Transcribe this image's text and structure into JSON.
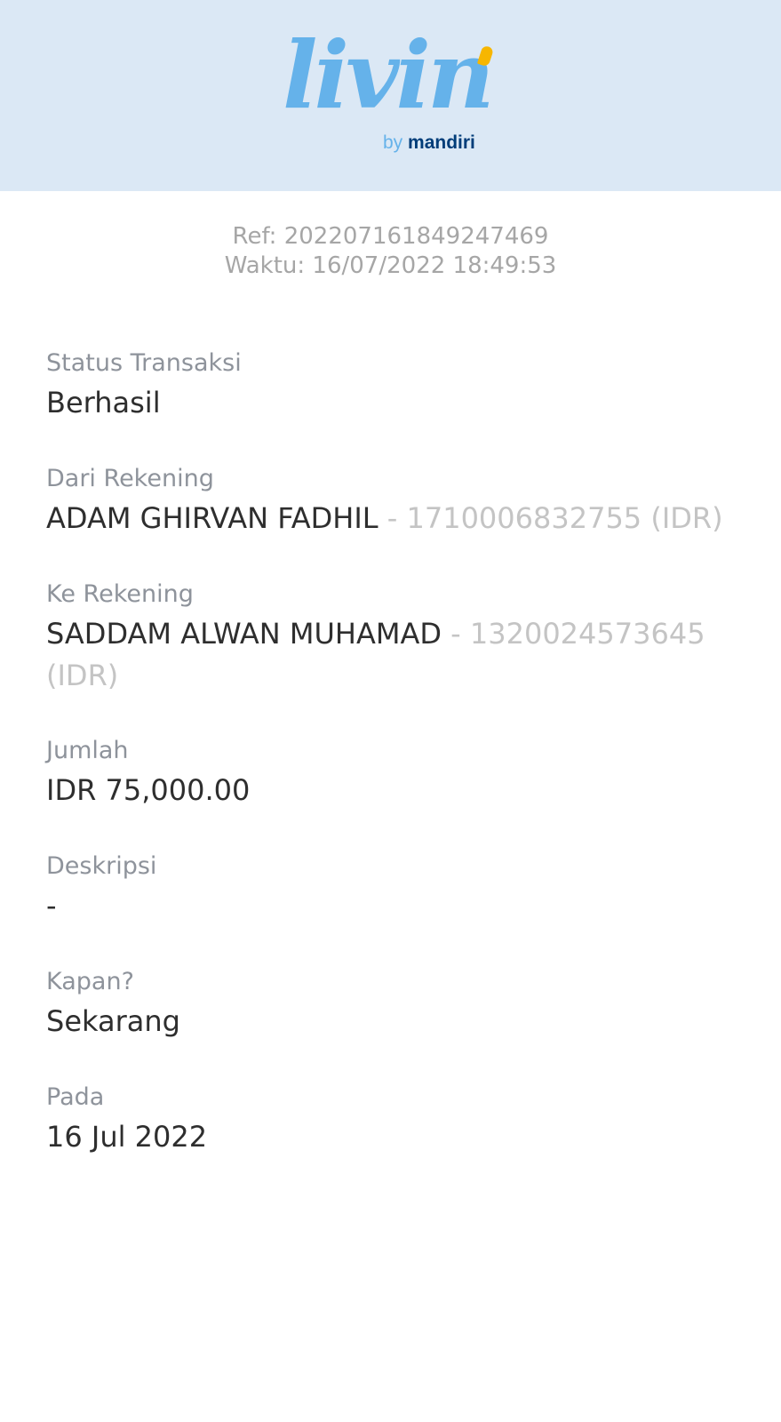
{
  "header": {
    "logo_word": "livin",
    "logo_by": "by",
    "logo_brand": "mandiri",
    "background": "#dbe8f5",
    "logo_color": "#65b2ea",
    "brand_color": "#003d79",
    "accent_dot_color": "#f7b600"
  },
  "meta": {
    "ref": "Ref: 202207161849247469",
    "time": "Waktu: 16/07/2022 18:49:53"
  },
  "fields": {
    "status": {
      "label": "Status Transaksi",
      "value": "Berhasil"
    },
    "from": {
      "label": "Dari Rekening",
      "name": "ADAM GHIRVAN FADHIL",
      "account": " - 1710006832755 (IDR)"
    },
    "to": {
      "label": "Ke Rekening",
      "name": "SADDAM ALWAN MUHAMAD",
      "account": " - 1320024573645 (IDR)"
    },
    "amount": {
      "label": "Jumlah",
      "value": "IDR 75,000.00"
    },
    "description": {
      "label": "Deskripsi",
      "value": "-"
    },
    "when": {
      "label": "Kapan?",
      "value": "Sekarang"
    },
    "date": {
      "label": "Pada",
      "value": "16 Jul 2022"
    }
  }
}
